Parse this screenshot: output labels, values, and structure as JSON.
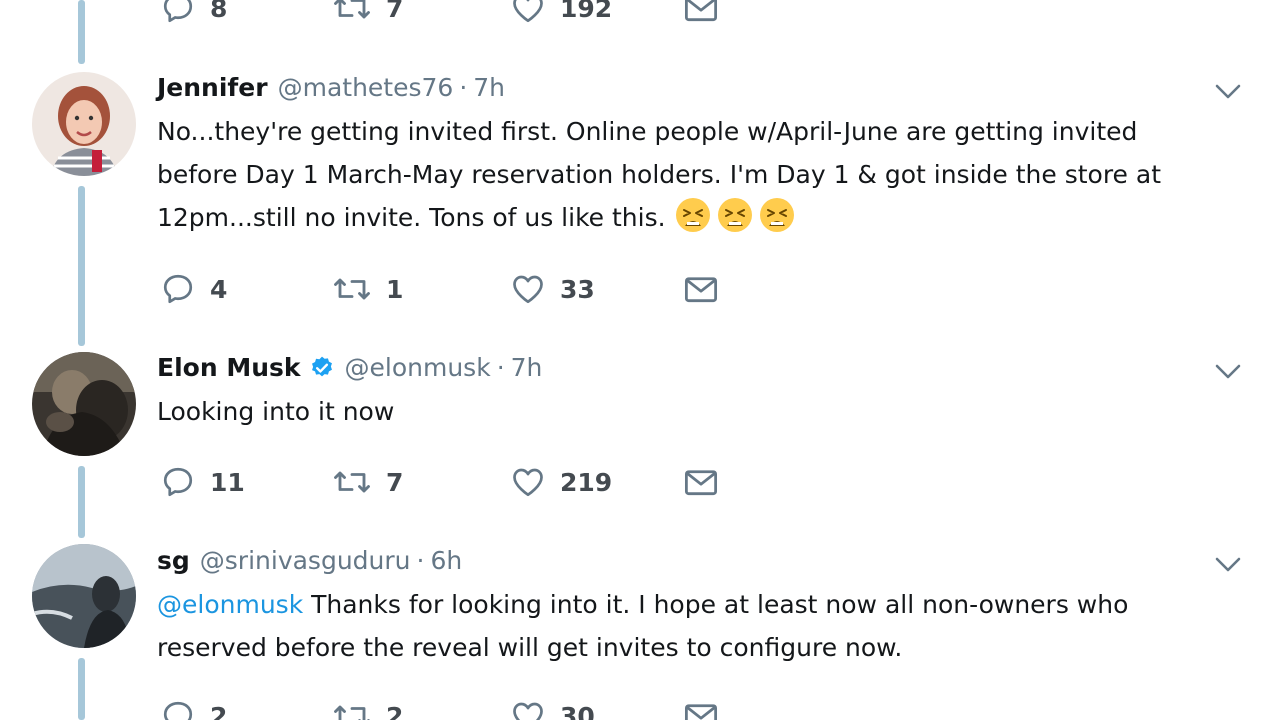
{
  "tweets": [
    {
      "actions": {
        "reply": "8",
        "retweet": "7",
        "like": "192"
      }
    },
    {
      "name": "Jennifer",
      "handle": "@mathetes76",
      "separator": "·",
      "time": "7h",
      "text_lines": [
        "No...they're getting invited first. Online people w/April-June are getting invited",
        "before Day 1 March-May reservation holders. I'm Day 1 & got inside the store at",
        "12pm...still no invite. Tons of us like this."
      ],
      "emojis": [
        "tired-face-emoji",
        "tired-face-emoji",
        "tired-face-emoji"
      ],
      "actions": {
        "reply": "4",
        "retweet": "1",
        "like": "33"
      }
    },
    {
      "name": "Elon Musk",
      "handle": "@elonmusk",
      "separator": "·",
      "time": "7h",
      "verified": true,
      "text_lines": [
        "Looking into it now"
      ],
      "actions": {
        "reply": "11",
        "retweet": "7",
        "like": "219"
      }
    },
    {
      "name": "sg",
      "handle": "@srinivasguduru",
      "separator": "·",
      "time": "6h",
      "mention": "@elonmusk",
      "text_lines": [
        " Thanks for looking into it. I hope at least now all non-owners who",
        "reserved before the reveal will get invites to configure now."
      ],
      "actions": {
        "reply": "2",
        "retweet": "2",
        "like": "30"
      }
    }
  ],
  "colors": {
    "thread_line": "#a6c7d9",
    "mention": "#1b95e0",
    "meta": "#657786",
    "verified": "#1da1f2"
  }
}
